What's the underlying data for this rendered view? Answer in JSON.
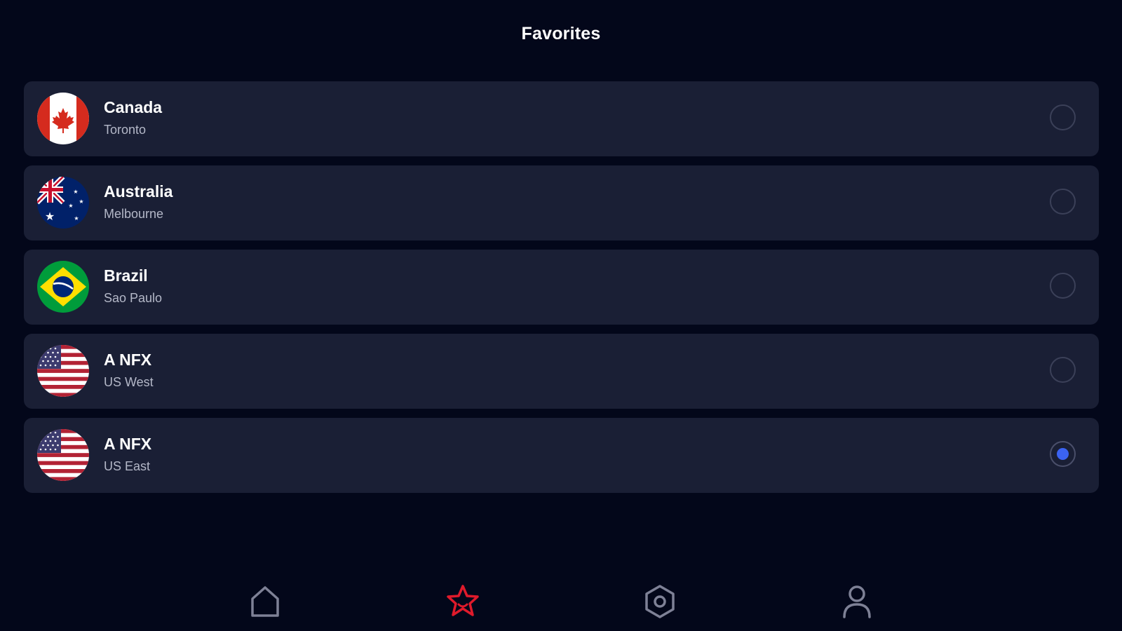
{
  "header": {
    "title": "Favorites"
  },
  "favorites": [
    {
      "country": "Canada",
      "city": "Toronto",
      "flag": "canada-flag",
      "selected": false
    },
    {
      "country": "Australia",
      "city": "Melbourne",
      "flag": "australia-flag",
      "selected": false
    },
    {
      "country": "Brazil",
      "city": "Sao Paulo",
      "flag": "brazil-flag",
      "selected": false
    },
    {
      "country": "A NFX",
      "city": "US West",
      "flag": "usa-flag",
      "selected": false
    },
    {
      "country": "A NFX",
      "city": "US East",
      "flag": "usa-flag",
      "selected": true
    }
  ],
  "nav": [
    {
      "icon": "home-icon",
      "active": false
    },
    {
      "icon": "star-icon",
      "active": true
    },
    {
      "icon": "settings-icon",
      "active": false
    },
    {
      "icon": "user-icon",
      "active": false
    }
  ],
  "colors": {
    "background": "#03071a",
    "card": "#1a1f35",
    "accent_selected": "#3b63f2",
    "nav_active": "#e01a2b",
    "nav_inactive": "#7e8196"
  }
}
